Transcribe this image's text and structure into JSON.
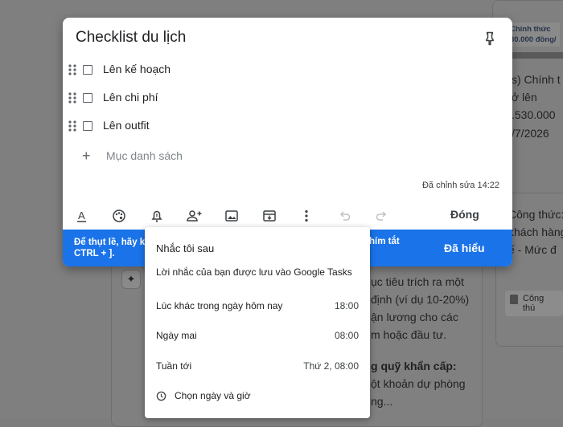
{
  "background": {
    "badge_line1": "Chính thức",
    "badge_line2": "30.000 đồng/",
    "right_lines": [
      "s) Chính t",
      "ở lên",
      ".530.000",
      "/7/2026"
    ],
    "right_card_lines": [
      "Công thức:",
      "khách hàng",
      "ế - Mức đ"
    ],
    "chip_label": "Công thú",
    "middle_lines": [
      "ục tiêu trích ra một",
      "định (ví dụ 10-20%)",
      "ận lương cho các",
      "m hoặc đầu tư."
    ],
    "middle_bold": "g quỹ khẩn cấp:",
    "middle_lines2": [
      "ột khoản dự phòng",
      "ng..."
    ]
  },
  "note": {
    "title": "Checklist du lịch",
    "items": [
      {
        "label": "Lên kế hoạch",
        "checked": false
      },
      {
        "label": "Lên chi phí",
        "checked": false
      },
      {
        "label": "Lên outfit",
        "checked": false
      }
    ],
    "add_item_placeholder": "Mục danh sách",
    "edited": "Đã chỉnh sửa 14:22",
    "close_label": "Đóng"
  },
  "tip": {
    "text_left": "Để thụt lề, hãy ke CTRL + ].",
    "text_right": "hím tắt",
    "button": "Đã hiểu"
  },
  "reminder": {
    "title": "Nhắc tôi sau",
    "subtitle": "Lời nhắc của bạn được lưu vào Google Tasks",
    "options": [
      {
        "label": "Lúc khác trong ngày hôm nay",
        "time": "18:00"
      },
      {
        "label": "Ngày mai",
        "time": "08:00"
      },
      {
        "label": "Tuần tới",
        "time": "Thứ 2, 08:00"
      }
    ],
    "pick": "Chọn ngày và giờ"
  },
  "colors": {
    "accent": "#1a73e8",
    "icon": "#5f6368",
    "text": "#202124"
  }
}
